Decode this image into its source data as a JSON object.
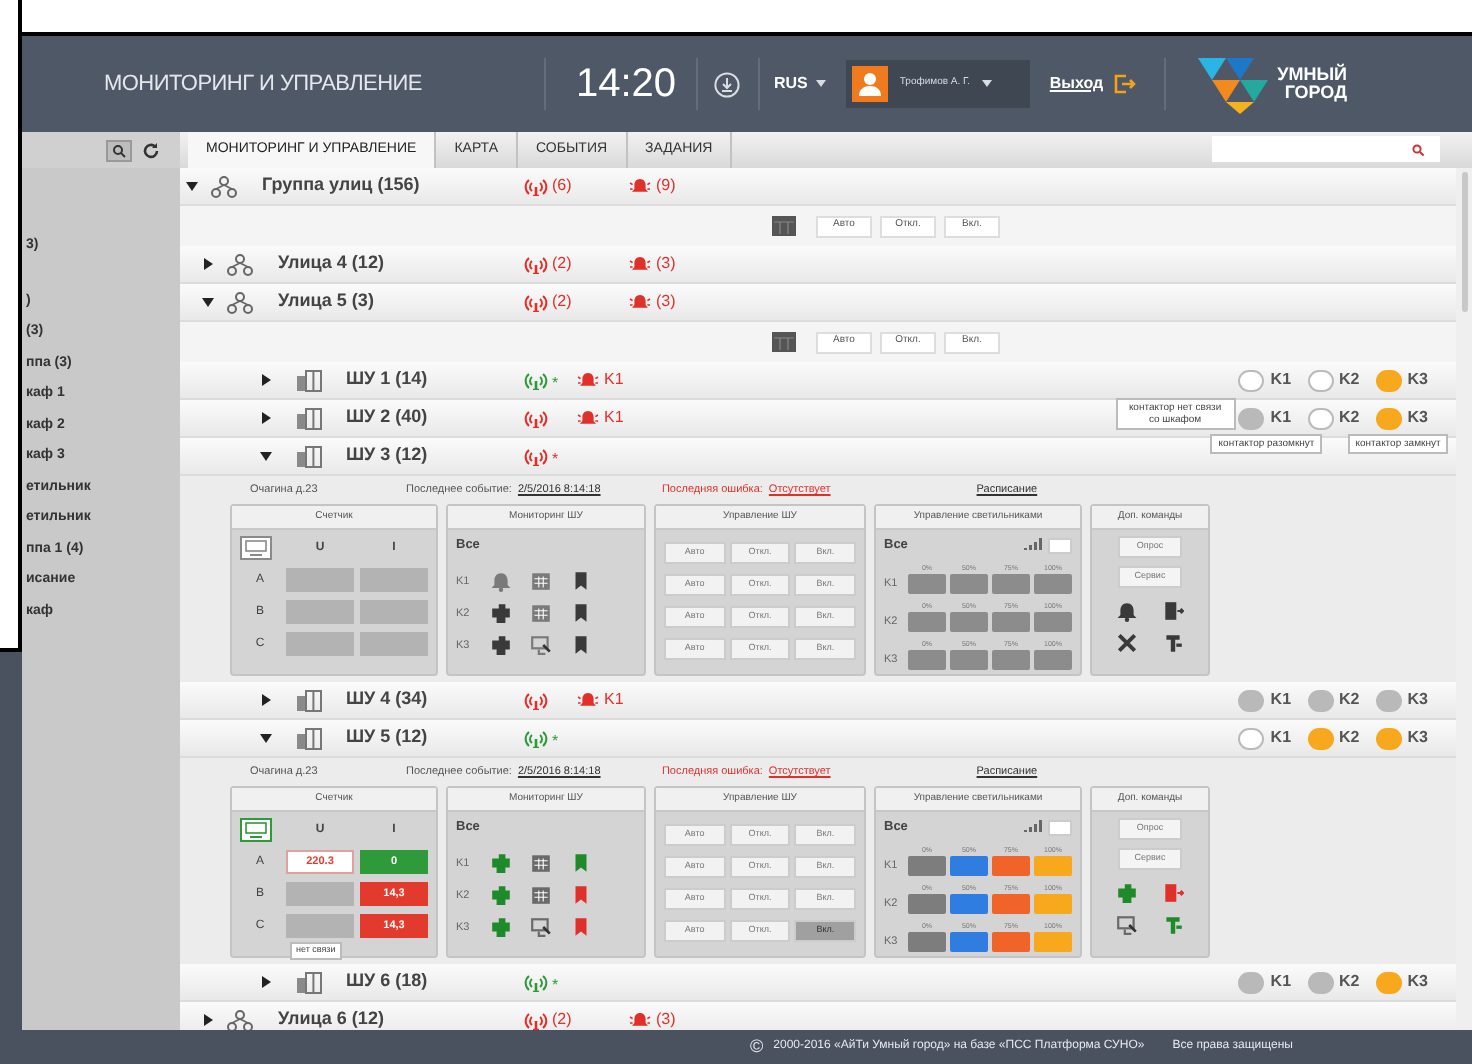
{
  "header": {
    "title": "МОНИТОРИНГ И УПРАВЛЕНИЕ",
    "time": "14:20",
    "language": "RUS",
    "user": "Трофимов А. Г.",
    "logout": "Выход",
    "logo": [
      "УМНЫЙ",
      "ГОРОД"
    ]
  },
  "sidebar": {
    "items": [
      "3)",
      ")",
      "(3)",
      "ппа (3)",
      "каф 1",
      "каф 2",
      "каф 3",
      "етильник",
      "етильник",
      "ппа 1 (4)",
      "исание",
      "каф"
    ]
  },
  "tabs": [
    {
      "label": "МОНИТОРИНГ И УПРАВЛЕНИЕ",
      "selected": true
    },
    {
      "label": "КАРТА",
      "selected": false
    },
    {
      "label": "СОБЫТИЯ",
      "selected": false
    },
    {
      "label": "ЗАДАНИЯ",
      "selected": false
    }
  ],
  "tree": [
    {
      "kind": "group",
      "label": "Группа улиц (156)",
      "expanded": true,
      "link": {
        "ok": false,
        "text": "(6)"
      },
      "alarm": {
        "text": "(9)"
      },
      "controls": [
        "Авто",
        "Откл.",
        "Вкл."
      ],
      "children": [
        {
          "kind": "group",
          "label": "Улица 4 (12)",
          "expanded": false,
          "link": {
            "ok": false,
            "text": "(2)"
          },
          "alarm": {
            "text": "(3)"
          }
        },
        {
          "kind": "group",
          "label": "Улица 5 (3)",
          "expanded": true,
          "link": {
            "ok": false,
            "text": "(2)"
          },
          "alarm": {
            "text": "(3)"
          },
          "controls": [
            "Авто",
            "Откл.",
            "Вкл."
          ],
          "children": [
            {
              "kind": "cabinet",
              "label": "ШУ 1 (14)",
              "expanded": false,
              "link": {
                "ok": true,
                "text": "*"
              },
              "alarm": {
                "text": "K1"
              },
              "contactors": [
                {
                  "label": "K1",
                  "connected": true,
                  "closed": false
                },
                {
                  "label": "K2",
                  "connected": true,
                  "closed": false
                },
                {
                  "label": "K3",
                  "connected": true,
                  "closed": true
                }
              ]
            },
            {
              "kind": "cabinet",
              "label": "ШУ 2 (40)",
              "expanded": false,
              "link": {
                "ok": false
              },
              "alarm": {
                "text": "K1"
              },
              "contactors": [
                {
                  "label": "K1",
                  "connected": false,
                  "closed": false,
                  "tooltips": [
                    {
                      "text": "контактор нет связи со шкафом",
                      "kind": "side"
                    },
                    {
                      "text": "контактор разомкнут",
                      "kind": "below"
                    }
                  ]
                },
                {
                  "label": "K2",
                  "connected": true,
                  "closed": false
                },
                {
                  "label": "K3",
                  "connected": true,
                  "closed": true,
                  "tooltips": [
                    {
                      "text": "контактор замкнут",
                      "kind": "below"
                    }
                  ]
                }
              ]
            },
            {
              "kind": "cabinet",
              "label": "ШУ 3 (12)",
              "expanded": true,
              "link": {
                "ok": false,
                "text": "*"
              },
              "details": {
                "address": "Очагина д.23",
                "last_event_label": "Последнее событие:",
                "last_event": "2/5/2016 8:14:18",
                "last_error_label": "Последняя ошибка:",
                "last_error": "Отсутствует",
                "schedule": "Расписание",
                "meter": {
                  "title": "Счетчик",
                  "icon": {
                    "color": "#8a8a8a"
                  },
                  "columns": [
                    "U",
                    "I"
                  ],
                  "rows": [
                    {
                      "phase": "A",
                      "u": {
                        "kind": "empty"
                      },
                      "i": {
                        "kind": "empty"
                      }
                    },
                    {
                      "phase": "B",
                      "u": {
                        "kind": "empty"
                      },
                      "i": {
                        "kind": "empty"
                      }
                    },
                    {
                      "phase": "C",
                      "u": {
                        "kind": "empty"
                      },
                      "i": {
                        "kind": "empty"
                      }
                    }
                  ]
                },
                "monitoring": {
                  "title": "Мониторинг ШУ",
                  "all": "Все",
                  "rows": [
                    {
                      "label": "K1",
                      "icons": [
                        {
                          "kind": "bell",
                          "color": "#7a7a7a"
                        },
                        {
                          "kind": "calendar",
                          "color": "#7a7a7a"
                        },
                        {
                          "kind": "flag",
                          "color": "#3a3a3a"
                        }
                      ]
                    },
                    {
                      "label": "K2",
                      "icons": [
                        {
                          "kind": "plug",
                          "color": "#3a3a3a"
                        },
                        {
                          "kind": "calendar",
                          "color": "#7a7a7a"
                        },
                        {
                          "kind": "flag",
                          "color": "#3a3a3a"
                        }
                      ]
                    },
                    {
                      "label": "K3",
                      "icons": [
                        {
                          "kind": "plug",
                          "color": "#3a3a3a"
                        },
                        {
                          "kind": "monitor",
                          "color": "#7a7a7a"
                        },
                        {
                          "kind": "flag",
                          "color": "#3a3a3a"
                        }
                      ]
                    }
                  ]
                },
                "control": {
                  "title": "Управление ШУ",
                  "rows": [
                    [
                      {
                        "label": "Авто",
                        "selected": false
                      },
                      {
                        "label": "Откл.",
                        "selected": false
                      },
                      {
                        "label": "Вкл.",
                        "selected": false
                      }
                    ],
                    [
                      {
                        "label": "Авто",
                        "selected": false
                      },
                      {
                        "label": "Откл.",
                        "selected": false
                      },
                      {
                        "label": "Вкл.",
                        "selected": false
                      }
                    ],
                    [
                      {
                        "label": "Авто",
                        "selected": false
                      },
                      {
                        "label": "Откл.",
                        "selected": false
                      },
                      {
                        "label": "Вкл.",
                        "selected": false
                      }
                    ],
                    [
                      {
                        "label": "Авто",
                        "selected": false
                      },
                      {
                        "label": "Откл.",
                        "selected": false
                      },
                      {
                        "label": "Вкл.",
                        "selected": false
                      }
                    ]
                  ]
                },
                "lighting": {
                  "title": "Управление светильниками",
                  "all": "Все",
                  "rows": [
                    {
                      "label": "K1",
                      "levels": [
                        {
                          "label": "0%",
                          "color": "#8c8c8c"
                        },
                        {
                          "label": "50%",
                          "color": "#8c8c8c"
                        },
                        {
                          "label": "75%",
                          "color": "#8c8c8c"
                        },
                        {
                          "label": "100%",
                          "color": "#8c8c8c"
                        }
                      ]
                    },
                    {
                      "label": "K2",
                      "levels": [
                        {
                          "label": "0%",
                          "color": "#8c8c8c"
                        },
                        {
                          "label": "50%",
                          "color": "#8c8c8c"
                        },
                        {
                          "label": "75%",
                          "color": "#8c8c8c"
                        },
                        {
                          "label": "100%",
                          "color": "#8c8c8c"
                        }
                      ]
                    },
                    {
                      "label": "K3",
                      "levels": [
                        {
                          "label": "0%",
                          "color": "#8c8c8c"
                        },
                        {
                          "label": "50%",
                          "color": "#8c8c8c"
                        },
                        {
                          "label": "75%",
                          "color": "#8c8c8c"
                        },
                        {
                          "label": "100%",
                          "color": "#8c8c8c"
                        }
                      ]
                    }
                  ]
                },
                "extra": {
                  "title": "Доп. команды",
                  "buttons": [
                    "Опрос",
                    "Сервис"
                  ],
                  "icons": [
                    {
                      "kind": "bell",
                      "color": "#3a3a3a"
                    },
                    {
                      "kind": "door",
                      "color": "#3a3a3a"
                    },
                    {
                      "kind": "tools",
                      "color": "#3a3a3a"
                    },
                    {
                      "kind": "pipe",
                      "color": "#3a3a3a"
                    }
                  ]
                }
              }
            },
            {
              "kind": "cabinet",
              "label": "ШУ 4 (34)",
              "expanded": false,
              "link": {
                "ok": false
              },
              "alarm": {
                "text": "K1"
              },
              "contactors": [
                {
                  "label": "K1",
                  "connected": false,
                  "closed": false
                },
                {
                  "label": "K2",
                  "connected": false,
                  "closed": false
                },
                {
                  "label": "K3",
                  "connected": false,
                  "closed": false
                }
              ]
            },
            {
              "kind": "cabinet",
              "label": "ШУ 5 (12)",
              "expanded": true,
              "link": {
                "ok": true,
                "text": "*"
              },
              "contactors": [
                {
                  "label": "K1",
                  "connected": true,
                  "closed": false
                },
                {
                  "label": "K2",
                  "connected": true,
                  "closed": true
                },
                {
                  "label": "K3",
                  "connected": true,
                  "closed": true
                }
              ],
              "details": {
                "address": "Очагина д.23",
                "last_event_label": "Последнее событие:",
                "last_event": "2/5/2016 8:14:18",
                "last_error_label": "Последняя ошибка:",
                "last_error": "Отсутствует",
                "schedule": "Расписание",
                "meter": {
                  "title": "Счетчик",
                  "icon": {
                    "color": "#2e9a3a"
                  },
                  "columns": [
                    "U",
                    "I"
                  ],
                  "rows": [
                    {
                      "phase": "A",
                      "u": {
                        "kind": "warning",
                        "value": "220.3"
                      },
                      "i": {
                        "kind": "ok",
                        "value": "0"
                      }
                    },
                    {
                      "phase": "B",
                      "u": {
                        "kind": "empty"
                      },
                      "i": {
                        "kind": "alarm",
                        "value": "14,3"
                      }
                    },
                    {
                      "phase": "C",
                      "u": {
                        "kind": "empty",
                        "tooltip": "нет связи"
                      },
                      "i": {
                        "kind": "alarm",
                        "value": "14,3"
                      }
                    }
                  ]
                },
                "monitoring": {
                  "title": "Мониторинг ШУ",
                  "all": "Все",
                  "rows": [
                    {
                      "label": "K1",
                      "icons": [
                        {
                          "kind": "plug",
                          "color": "#1f8a2a"
                        },
                        {
                          "kind": "calendar",
                          "color": "#6a6a6a"
                        },
                        {
                          "kind": "flag",
                          "color": "#1f8a2a"
                        }
                      ]
                    },
                    {
                      "label": "K2",
                      "icons": [
                        {
                          "kind": "plug",
                          "color": "#1f8a2a"
                        },
                        {
                          "kind": "calendar",
                          "color": "#6a6a6a"
                        },
                        {
                          "kind": "flag",
                          "color": "#e0302a"
                        }
                      ]
                    },
                    {
                      "label": "K3",
                      "icons": [
                        {
                          "kind": "plug",
                          "color": "#1f8a2a"
                        },
                        {
                          "kind": "monitor",
                          "color": "#6a6a6a"
                        },
                        {
                          "kind": "flag",
                          "color": "#e0302a"
                        }
                      ]
                    }
                  ]
                },
                "control": {
                  "title": "Управление ШУ",
                  "rows": [
                    [
                      {
                        "label": "Авто",
                        "selected": false
                      },
                      {
                        "label": "Откл.",
                        "selected": false
                      },
                      {
                        "label": "Вкл.",
                        "selected": false
                      }
                    ],
                    [
                      {
                        "label": "Авто",
                        "selected": false
                      },
                      {
                        "label": "Откл.",
                        "selected": false
                      },
                      {
                        "label": "Вкл.",
                        "selected": false
                      }
                    ],
                    [
                      {
                        "label": "Авто",
                        "selected": false
                      },
                      {
                        "label": "Откл.",
                        "selected": false
                      },
                      {
                        "label": "Вкл.",
                        "selected": false
                      }
                    ],
                    [
                      {
                        "label": "Авто",
                        "selected": false
                      },
                      {
                        "label": "Откл.",
                        "selected": false
                      },
                      {
                        "label": "Вкл.",
                        "selected": true
                      }
                    ]
                  ]
                },
                "lighting": {
                  "title": "Управление светильниками",
                  "all": "Все",
                  "rows": [
                    {
                      "label": "K1",
                      "levels": [
                        {
                          "label": "0%",
                          "color": "#7d7d7d"
                        },
                        {
                          "label": "50%",
                          "color": "#2f7de0"
                        },
                        {
                          "label": "75%",
                          "color": "#f0642a"
                        },
                        {
                          "label": "100%",
                          "color": "#f7a81c"
                        }
                      ]
                    },
                    {
                      "label": "K2",
                      "levels": [
                        {
                          "label": "0%",
                          "color": "#7d7d7d"
                        },
                        {
                          "label": "50%",
                          "color": "#2f7de0"
                        },
                        {
                          "label": "75%",
                          "color": "#f0642a"
                        },
                        {
                          "label": "100%",
                          "color": "#f7a81c"
                        }
                      ]
                    },
                    {
                      "label": "K3",
                      "levels": [
                        {
                          "label": "0%",
                          "color": "#7d7d7d"
                        },
                        {
                          "label": "50%",
                          "color": "#2f7de0"
                        },
                        {
                          "label": "75%",
                          "color": "#f0642a"
                        },
                        {
                          "label": "100%",
                          "color": "#f7a81c"
                        }
                      ]
                    }
                  ]
                },
                "extra": {
                  "title": "Доп. команды",
                  "buttons": [
                    "Опрос",
                    "Сервис"
                  ],
                  "icons": [
                    {
                      "kind": "plug",
                      "color": "#1f8a2a"
                    },
                    {
                      "kind": "door",
                      "color": "#e0302a"
                    },
                    {
                      "kind": "monitor",
                      "color": "#6a6a6a"
                    },
                    {
                      "kind": "pipe",
                      "color": "#1f8a2a"
                    }
                  ]
                }
              }
            },
            {
              "kind": "cabinet",
              "label": "ШУ 6 (18)",
              "expanded": false,
              "link": {
                "ok": true,
                "text": "*"
              },
              "contactors": [
                {
                  "label": "K1",
                  "connected": false,
                  "closed": false
                },
                {
                  "label": "K2",
                  "connected": false,
                  "closed": false
                },
                {
                  "label": "K3",
                  "connected": true,
                  "closed": true
                }
              ]
            }
          ]
        },
        {
          "kind": "group",
          "label": "Улица 6 (12)",
          "expanded": false,
          "link": {
            "ok": false,
            "text": "(2)"
          },
          "alarm": {
            "text": "(3)"
          }
        }
      ]
    }
  ],
  "footer": {
    "sign": "©",
    "text": "2000-2016  «АйТи Умный город» на базе «ПСС Платформа СУНО»",
    "rights": "Все права защищены"
  }
}
